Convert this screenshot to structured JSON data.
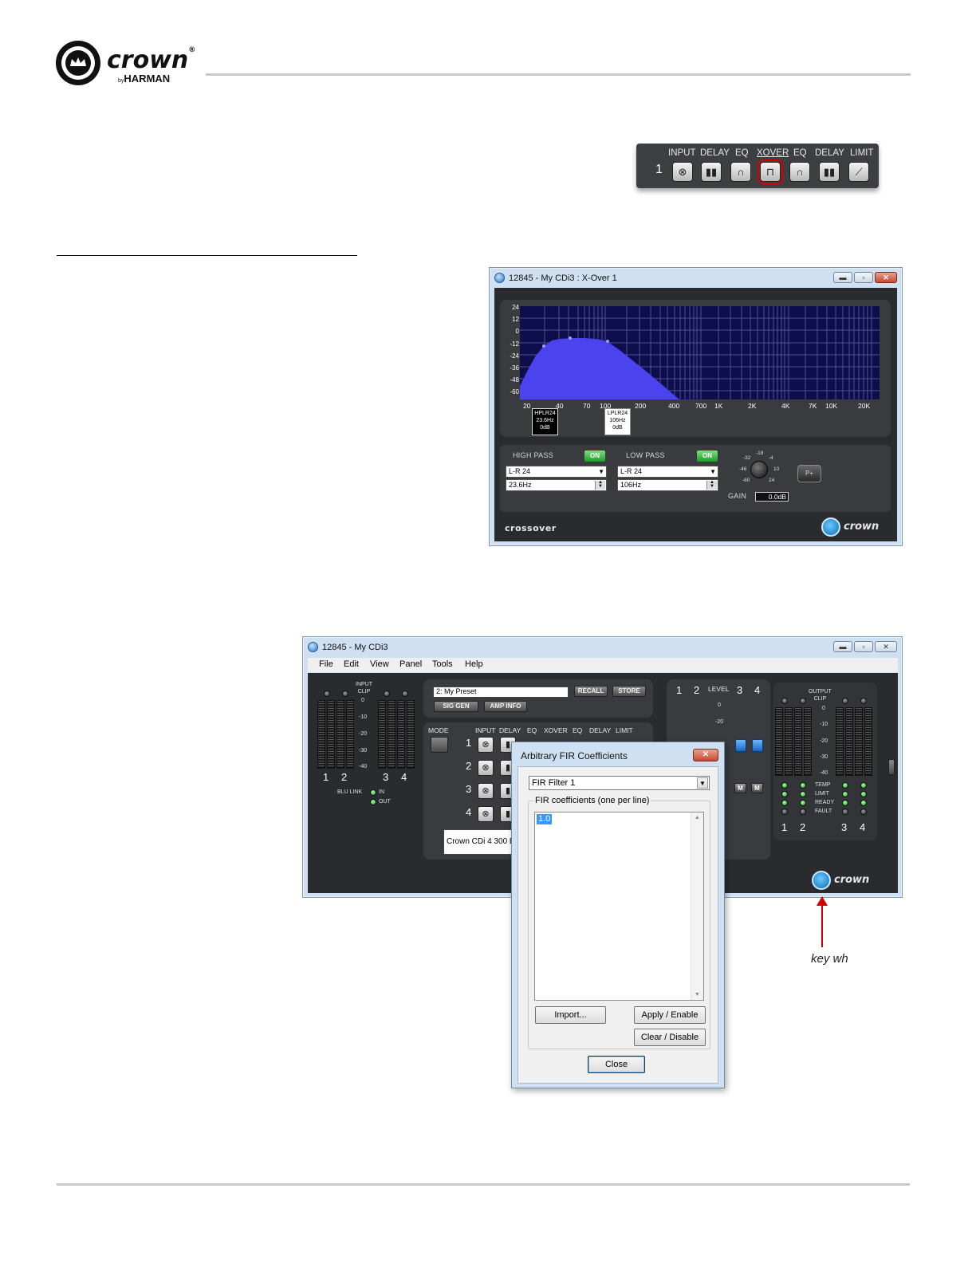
{
  "logo": {
    "word": "crown",
    "mark": "®",
    "by": "by",
    "maker": "HARMAN"
  },
  "signal_chain": {
    "channel": "1",
    "labels": [
      "INPUT",
      "DELAY",
      "EQ",
      "XOVER",
      "EQ",
      "DELAY",
      "LIMIT"
    ],
    "selected": "XOVER"
  },
  "xover_window": {
    "title": "12845 - My CDi3 : X-Over 1",
    "y_ticks": [
      "24",
      "12",
      "0",
      "-12",
      "-24",
      "-36",
      "-48",
      "-60"
    ],
    "x_ticks": [
      "20",
      "40",
      "70",
      "100",
      "200",
      "400",
      "700",
      "1K",
      "2K",
      "4K",
      "7K",
      "10K",
      "20K"
    ],
    "hp_box": [
      "HPLR24",
      "23.6Hz",
      "0dB"
    ],
    "lp_box": [
      "LPLR24",
      "106Hz",
      "0dB"
    ],
    "high_pass": {
      "label": "HIGH PASS",
      "on": "ON",
      "type": "L-R 24",
      "freq": "23.6Hz"
    },
    "low_pass": {
      "label": "LOW PASS",
      "on": "ON",
      "type": "L-R 24",
      "freq": "106Hz"
    },
    "knob_ticks": [
      "-18",
      "-4",
      "-32",
      "-46",
      "-60",
      "10",
      "24"
    ],
    "gain_label": "GAIN",
    "gain_value": "0.0dB",
    "pbtn": "P+",
    "footer_label": "crossover",
    "brand": "crown",
    "colors": {
      "fill": "#4b43ee",
      "grid": "#5a5aa0"
    }
  },
  "device_window": {
    "title": "12845 - My CDi3",
    "menu": [
      "File",
      "Edit",
      "View",
      "Panel",
      "Tools",
      "Help"
    ],
    "input_clip": "INPUT\nCLIP",
    "input_scale": [
      "0",
      "-10",
      "-20",
      "-30",
      "-40"
    ],
    "channels_in": [
      "1",
      "2",
      "3",
      "4"
    ],
    "blu_link": "BLU LINK",
    "blu_in": "IN",
    "blu_out": "OUT",
    "preset_value": "2: My Preset",
    "recall": "RECALL",
    "store": "STORE",
    "sig_gen": "SIG GEN",
    "amp_info": "AMP INFO",
    "mode": "MODE",
    "row_headers": [
      "INPUT",
      "DELAY",
      "EQ",
      "XOVER",
      "EQ",
      "DELAY",
      "LIMIT"
    ],
    "rows": [
      "1",
      "2",
      "3",
      "4"
    ],
    "model": "Crown CDi 4 300 BL",
    "level_label": "LEVEL",
    "level_channels": [
      "1",
      "2",
      "3",
      "4"
    ],
    "level_scale": [
      "0",
      "-20"
    ],
    "mute": "M",
    "output_clip": "OUTPUT\nCLIP",
    "output_scale": [
      "0",
      "-10",
      "-20",
      "-30",
      "-40"
    ],
    "status": [
      "TEMP",
      "LIMIT",
      "READY",
      "FAULT"
    ],
    "channels_out": [
      "1",
      "2",
      "3",
      "4"
    ],
    "brand": "crown"
  },
  "fir_dialog": {
    "title": "Arbitrary FIR Coefficients",
    "filter_select": "FIR Filter 1",
    "group_label": "FIR coefficients (one per line)",
    "coefficients": "1.0",
    "import": "Import...",
    "apply": "Apply / Enable",
    "clear": "Clear / Disable",
    "close": "Close"
  },
  "caption": "key wh"
}
